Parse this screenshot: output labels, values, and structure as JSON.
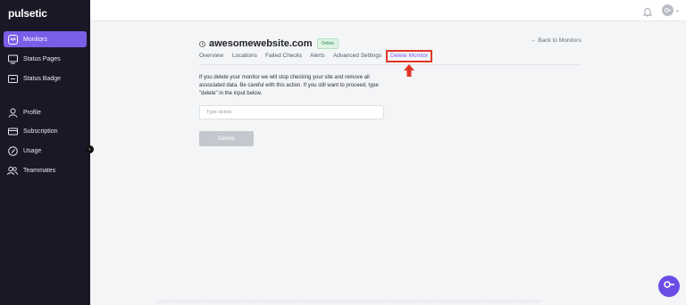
{
  "app": {
    "logo": "pulsetic"
  },
  "sidebar": {
    "items": [
      {
        "label": "Monitors",
        "icon": "monitor-icon",
        "active": true
      },
      {
        "label": "Status Pages",
        "icon": "screen-icon"
      },
      {
        "label": "Status Badge",
        "icon": "badge-icon"
      },
      {
        "label": "Profile",
        "icon": "user-icon"
      },
      {
        "label": "Subscription",
        "icon": "card-icon"
      },
      {
        "label": "Usage",
        "icon": "gauge-icon"
      },
      {
        "label": "Teammates",
        "icon": "users-icon"
      }
    ]
  },
  "header": {
    "site_name": "awesomewebsite.com",
    "status_badge": "Online",
    "back_link": "← Back to Monitors"
  },
  "tabs": [
    {
      "label": "Overview"
    },
    {
      "label": "Locations"
    },
    {
      "label": "Failed Checks"
    },
    {
      "label": "Alerts"
    },
    {
      "label": "Advanced Settings"
    },
    {
      "label": "Delete Monitor",
      "active": true
    }
  ],
  "content": {
    "description": "If you delete your monitor we will stop checking your site and remove all associated data. Be careful with this action. If you still want to proceed, type \"delete\" in the input below.",
    "input_placeholder": "Type delete",
    "delete_button": "Delete"
  },
  "colors": {
    "accent": "#7b5ee8",
    "sidebar_bg": "#1a1726",
    "highlight": "#e03526",
    "online": "#2f8a4a"
  }
}
